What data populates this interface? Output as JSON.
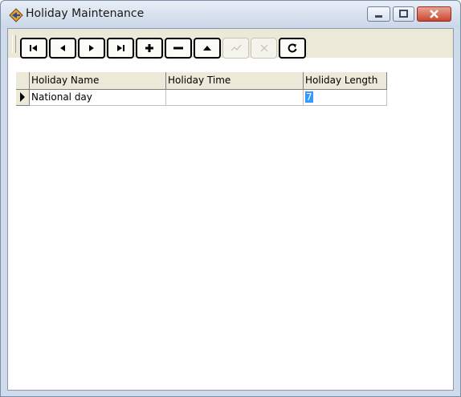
{
  "window": {
    "title": "Holiday Maintenance"
  },
  "toolbar": {
    "buttons": [
      {
        "name": "first-record-button",
        "icon": "first-record-icon",
        "enabled": true
      },
      {
        "name": "prior-record-button",
        "icon": "prior-record-icon",
        "enabled": true
      },
      {
        "name": "next-record-button",
        "icon": "next-record-icon",
        "enabled": true
      },
      {
        "name": "last-record-button",
        "icon": "last-record-icon",
        "enabled": true
      },
      {
        "name": "insert-record-button",
        "icon": "plus-icon",
        "enabled": true
      },
      {
        "name": "delete-record-button",
        "icon": "minus-icon",
        "enabled": true
      },
      {
        "name": "edit-record-button",
        "icon": "up-triangle-icon",
        "enabled": true
      },
      {
        "name": "post-edit-button",
        "icon": "checkmark-icon",
        "enabled": false
      },
      {
        "name": "cancel-edit-button",
        "icon": "x-icon",
        "enabled": false
      },
      {
        "name": "refresh-button",
        "icon": "refresh-icon",
        "enabled": true
      }
    ]
  },
  "grid": {
    "columns": [
      {
        "label": "Holiday Name"
      },
      {
        "label": "Holiday Time"
      },
      {
        "label": "Holiday Length"
      }
    ],
    "rows": [
      {
        "name": "National day",
        "time": "",
        "length": "7"
      }
    ]
  },
  "colors": {
    "selection": "#3399ff",
    "toolbar_bg": "#ece9d8",
    "title_gradient_top": "#e8eef6"
  }
}
